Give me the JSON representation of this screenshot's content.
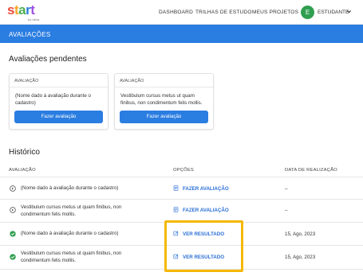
{
  "app": {
    "logo_s": "s",
    "logo_t": "t",
    "logo_a": "a",
    "logo_r": "r",
    "logo_t2": "t",
    "logo_sub": "by ulbra"
  },
  "nav": {
    "dashboard": "DASHBOARD",
    "trilhas": "TRILHAS DE ESTUDO",
    "projetos": "MEUS PROJETOS",
    "avatar_letter": "E",
    "user": "ESTUDANTE"
  },
  "banner": {
    "title": "AVALIAÇÕES"
  },
  "pending": {
    "title": "Avaliações pendentes",
    "cards": [
      {
        "head": "AVALIAÇÃO",
        "text": "(Nome dado à avaliação durante o cadastro)",
        "button": "Fazer avaliação"
      },
      {
        "head": "AVALIAÇÃO",
        "text": "Vestibulum cursus metus ut quam finibus, non condimentum felis mollis.",
        "button": "Fazer avaliação"
      }
    ]
  },
  "history": {
    "title": "Histórico",
    "columns": {
      "avaliacao": "AVALIAÇÃO",
      "opcoes": "OPÇÕES",
      "data": "DATA DE REALIZAÇÃO"
    },
    "rows": [
      {
        "status": "pending",
        "name": "(Nome dado à avaliação durante o cadastro)",
        "option": "FAZER AVALIAÇÃO",
        "date": "–"
      },
      {
        "status": "pending",
        "name": "Vestibulum cursus metus ut quam finibus, non condimentum felis mollis.",
        "option": "FAZER AVALIAÇÃO",
        "date": "–"
      },
      {
        "status": "done",
        "name": "(Nome dado à avaliação durante o cadastro)",
        "option": "VER RESULTADO",
        "date": "15, Ago, 2023"
      },
      {
        "status": "done",
        "name": "Vestibulum cursus metus ut quam finibus, non condimentum felis mollis.",
        "option": "VER RESULTADO",
        "date": "15, Ago, 2023"
      }
    ]
  },
  "colors": {
    "primary": "#2a7de1",
    "success": "#2e9e4f",
    "highlight": "#f5b800",
    "link": "#2a6fd6"
  }
}
